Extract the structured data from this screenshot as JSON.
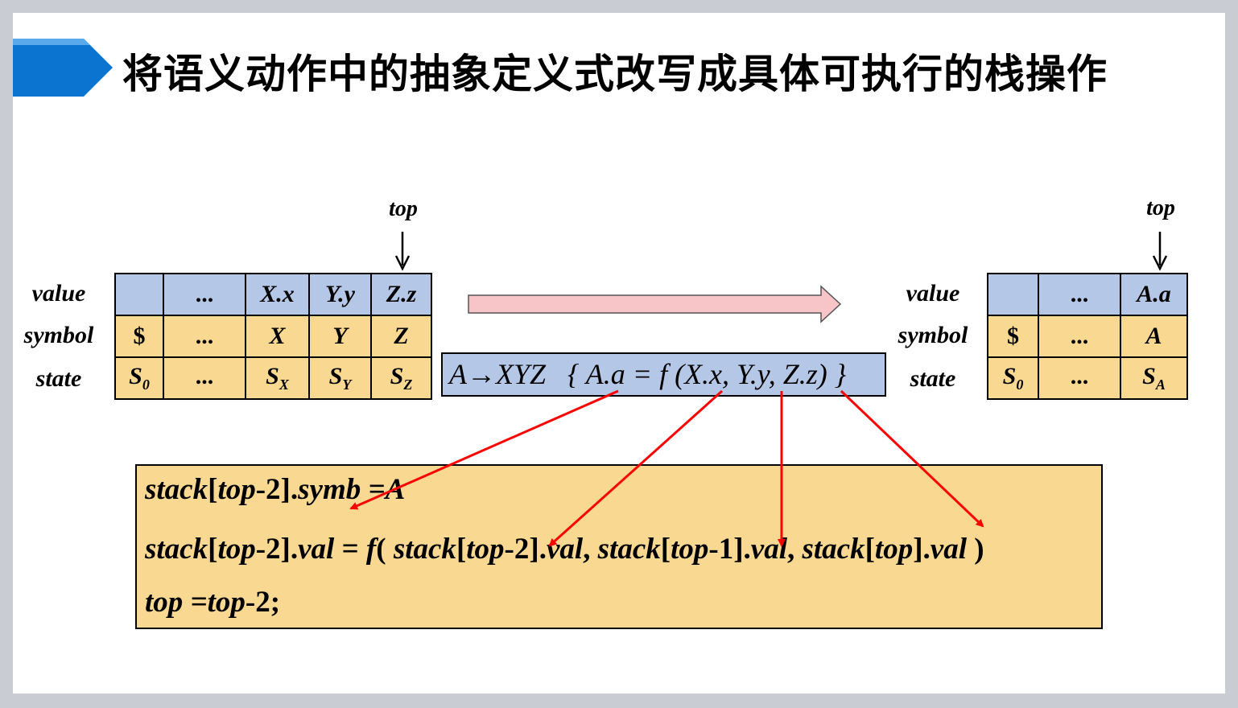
{
  "title": "将语义动作中的抽象定义式改写成具体可执行的栈操作",
  "colors": {
    "title_arrow": "#0b74d0",
    "value_row": "#b4c7e7",
    "symbol_state_rows": "#f9d892",
    "big_arrow_fill": "#f7c5c7",
    "red_arrows": "#ff0000"
  },
  "left_stack": {
    "top_label": "top",
    "row_labels": {
      "value": "value",
      "symbol": "symbol",
      "state": "state"
    },
    "value": [
      "",
      "...",
      "X.x",
      "Y.y",
      "Z.z"
    ],
    "symbol": [
      "$",
      "...",
      "X",
      "Y",
      "Z"
    ],
    "state": [
      {
        "main": "S",
        "sub": "0"
      },
      {
        "main": "...",
        "sub": ""
      },
      {
        "main": "S",
        "sub": "X"
      },
      {
        "main": "S",
        "sub": "Y"
      },
      {
        "main": "S",
        "sub": "Z"
      }
    ]
  },
  "right_stack": {
    "top_label": "top",
    "row_labels": {
      "value": "value",
      "symbol": "symbol",
      "state": "state"
    },
    "value": [
      "",
      "...",
      "A.a"
    ],
    "symbol": [
      "$",
      "...",
      "A"
    ],
    "state": [
      {
        "main": "S",
        "sub": "0"
      },
      {
        "main": "...",
        "sub": ""
      },
      {
        "main": "S",
        "sub": "A"
      }
    ]
  },
  "production": {
    "lhs": "A",
    "arrow": "→",
    "rhs": "XYZ",
    "action": "{ A.a = f (X.x, Y.y, Z.z) }"
  },
  "code": {
    "line1": {
      "a": "stack",
      "b": "[",
      "c": "top",
      "d": "-2].",
      "e": "symb",
      "f": " =A"
    },
    "line2": {
      "a": "stack",
      "b": "[",
      "c": "top",
      "d": "-2].",
      "e": "val",
      "f": " = ",
      "g": "f",
      "h": "( ",
      "i": "stack",
      "j": "[",
      "k": "top",
      "l": "-2].",
      "m": "val",
      "n": ", ",
      "o": "stack",
      "p": "[",
      "q": "top",
      "r": "-1].",
      "s": "val",
      "t": ", ",
      "u": "stack",
      "v": "[",
      "w": "top",
      "x": "].",
      "y": "val",
      "z": " )"
    },
    "line3": {
      "a": "top",
      "b": " =",
      "c": "top",
      "d": "-2;"
    }
  }
}
